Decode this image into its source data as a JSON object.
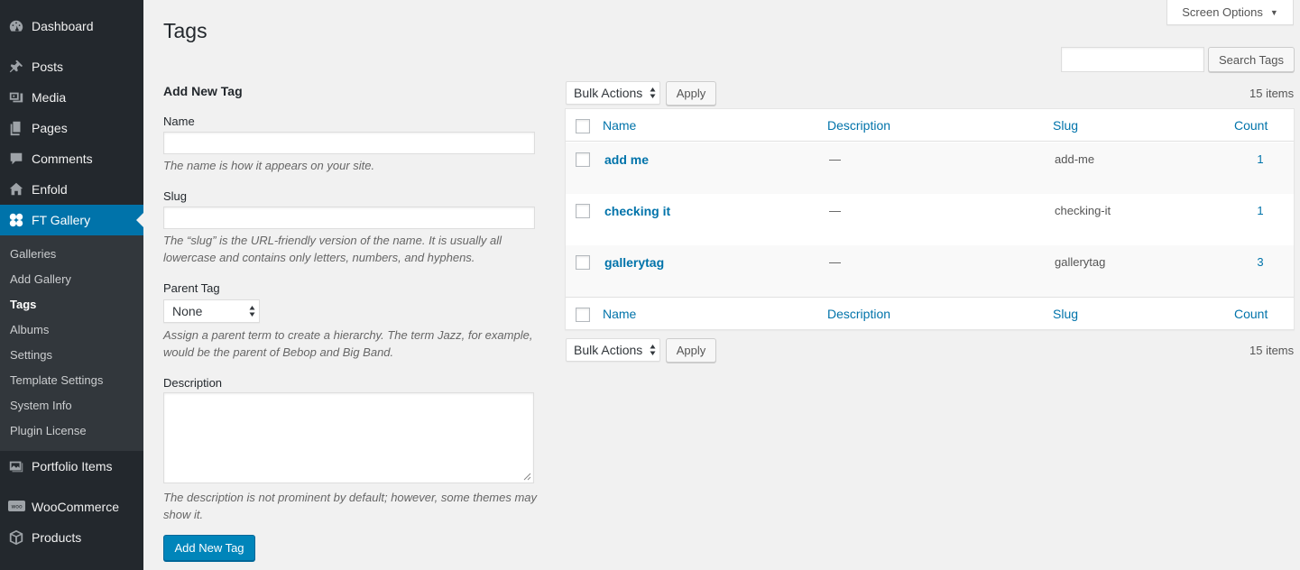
{
  "sidebar": {
    "menu": [
      {
        "label": "Dashboard",
        "icon": "dashboard-icon"
      },
      {
        "label": "Posts",
        "icon": "pin-icon"
      },
      {
        "label": "Media",
        "icon": "media-icon"
      },
      {
        "label": "Pages",
        "icon": "pages-icon"
      },
      {
        "label": "Comments",
        "icon": "comment-icon"
      },
      {
        "label": "Enfold",
        "icon": "home-icon"
      },
      {
        "label": "FT Gallery",
        "icon": "gallery-icon"
      }
    ],
    "submenu": [
      "Galleries",
      "Add Gallery",
      "Tags",
      "Albums",
      "Settings",
      "Template Settings",
      "System Info",
      "Plugin License"
    ],
    "bottom_menu": [
      {
        "label": "Portfolio Items",
        "icon": "portfolio-icon"
      },
      {
        "label": "WooCommerce",
        "icon": "woocommerce-icon"
      },
      {
        "label": "Products",
        "icon": "products-icon"
      }
    ]
  },
  "header": {
    "title": "Tags",
    "screen_options": "Screen Options"
  },
  "search": {
    "value": "",
    "button": "Search Tags"
  },
  "form": {
    "heading": "Add New Tag",
    "name_label": "Name",
    "name_value": "",
    "name_help": "The name is how it appears on your site.",
    "slug_label": "Slug",
    "slug_value": "",
    "slug_help": "The “slug” is the URL-friendly version of the name. It is usually all lowercase and contains only letters, numbers, and hyphens.",
    "parent_label": "Parent Tag",
    "parent_selected": "None",
    "parent_help": "Assign a parent term to create a hierarchy. The term Jazz, for example, would be the parent of Bebop and Big Band.",
    "description_label": "Description",
    "description_help": "The description is not prominent by default; however, some themes may show it.",
    "submit": "Add New Tag"
  },
  "table": {
    "bulk_actions": "Bulk Actions",
    "apply": "Apply",
    "items_count": "15 items",
    "columns": {
      "name": "Name",
      "description": "Description",
      "slug": "Slug",
      "count": "Count"
    },
    "rows": [
      {
        "name": "add me",
        "description": "—",
        "slug": "add-me",
        "count": "1"
      },
      {
        "name": "checking it",
        "description": "—",
        "slug": "checking-it",
        "count": "1"
      },
      {
        "name": "gallerytag",
        "description": "—",
        "slug": "gallerytag",
        "count": "3"
      }
    ]
  },
  "colors": {
    "sidebar_bg": "#23282d",
    "submenu_bg": "#32373c",
    "accent": "#0073aa",
    "primary_button": "#0085ba"
  }
}
